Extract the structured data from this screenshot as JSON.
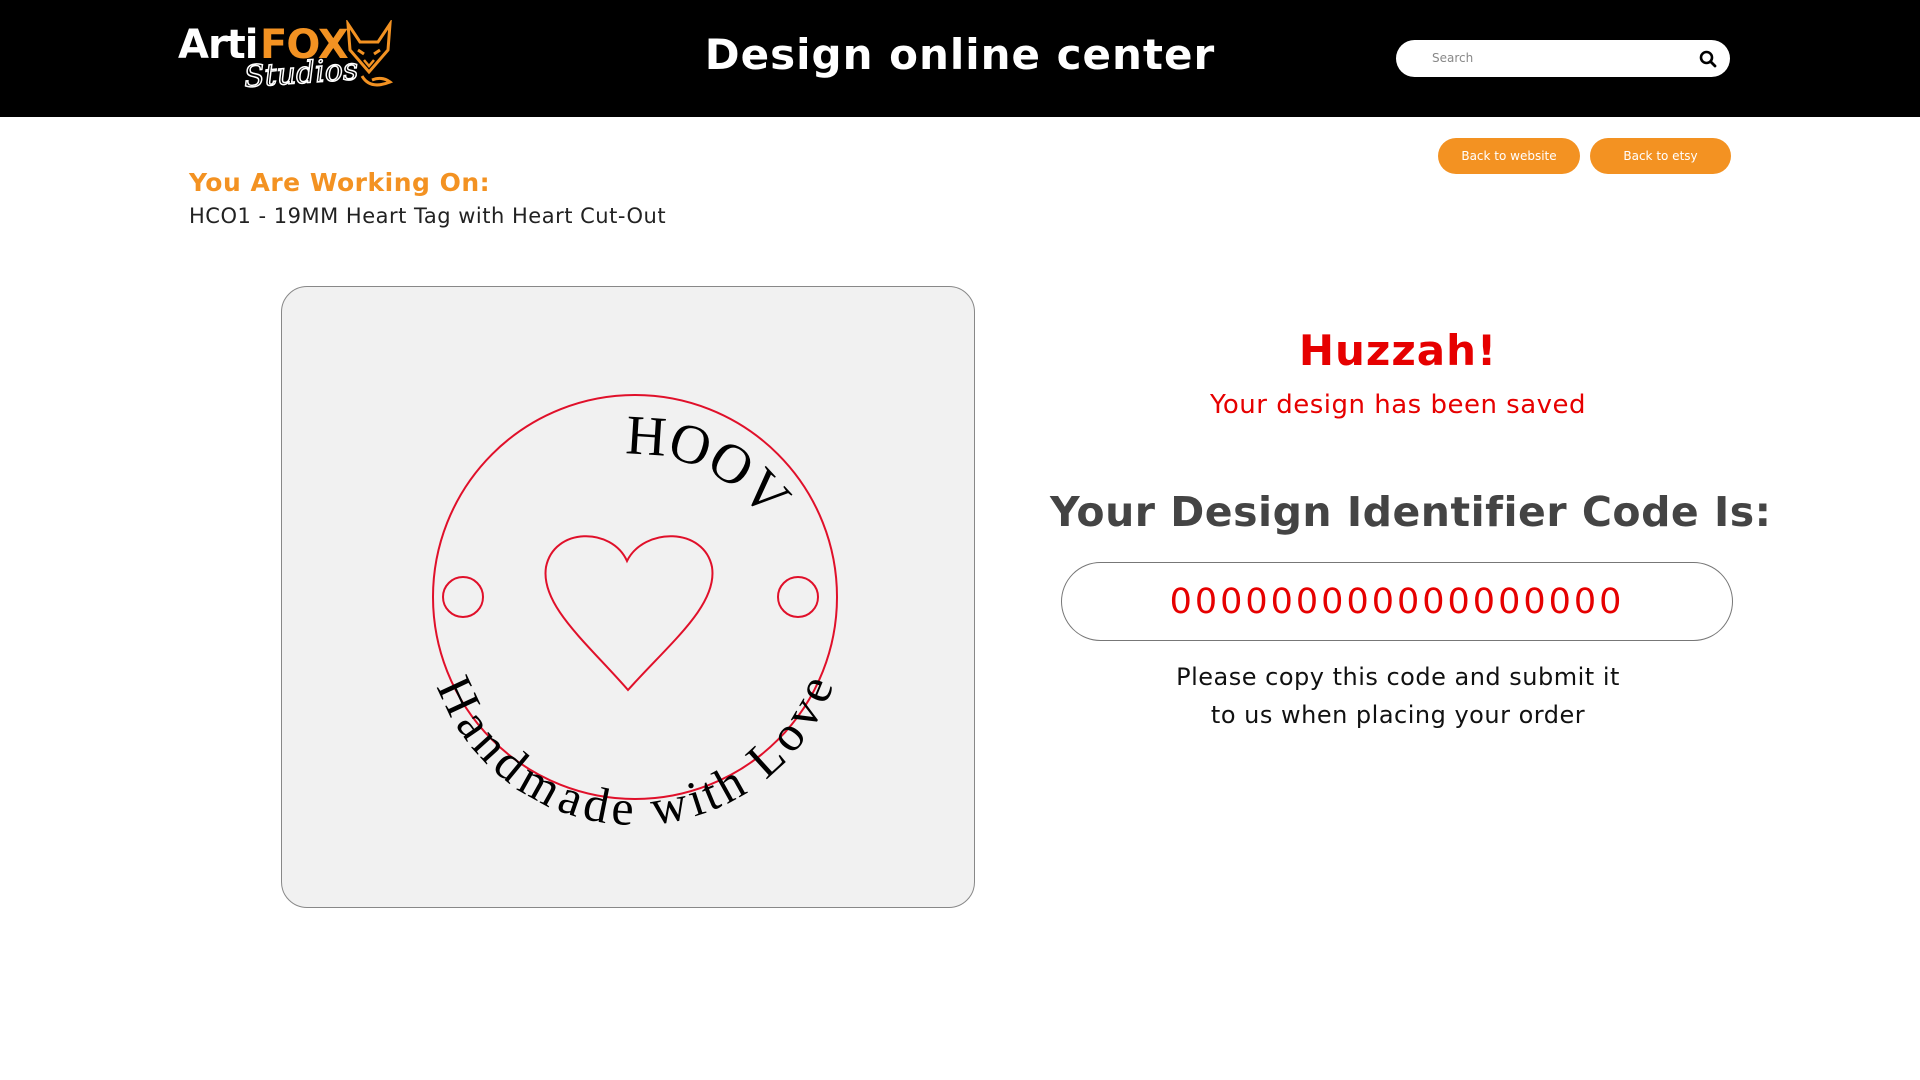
{
  "header": {
    "logo": {
      "brand_first": "Arti",
      "brand_second": "FOX",
      "brand_sub": "Studios"
    },
    "title": "Design online center",
    "search": {
      "placeholder": "Search",
      "value": "",
      "icon": "search-icon"
    }
  },
  "nav": {
    "back_to_website": "Back to website",
    "back_to_etsy": "Back to etsy"
  },
  "working_on": {
    "label": "You Are Working On:",
    "product": "HCO1 - 19MM Heart Tag with Heart Cut-Out"
  },
  "preview": {
    "top_text": "HOOV",
    "bottom_text": "Handmade with Love",
    "outline_color": "#e0102a"
  },
  "result": {
    "heading": "Huzzah!",
    "subheading": "Your design has been saved",
    "code_label": "Your Design Identifier Code Is:",
    "code": "000000000000000000",
    "instructions_line1": "Please copy this code and submit it",
    "instructions_line2": "to us when placing your order"
  },
  "colors": {
    "header_bg": "#000000",
    "accent": "#f39222",
    "success_red": "#e60000"
  }
}
